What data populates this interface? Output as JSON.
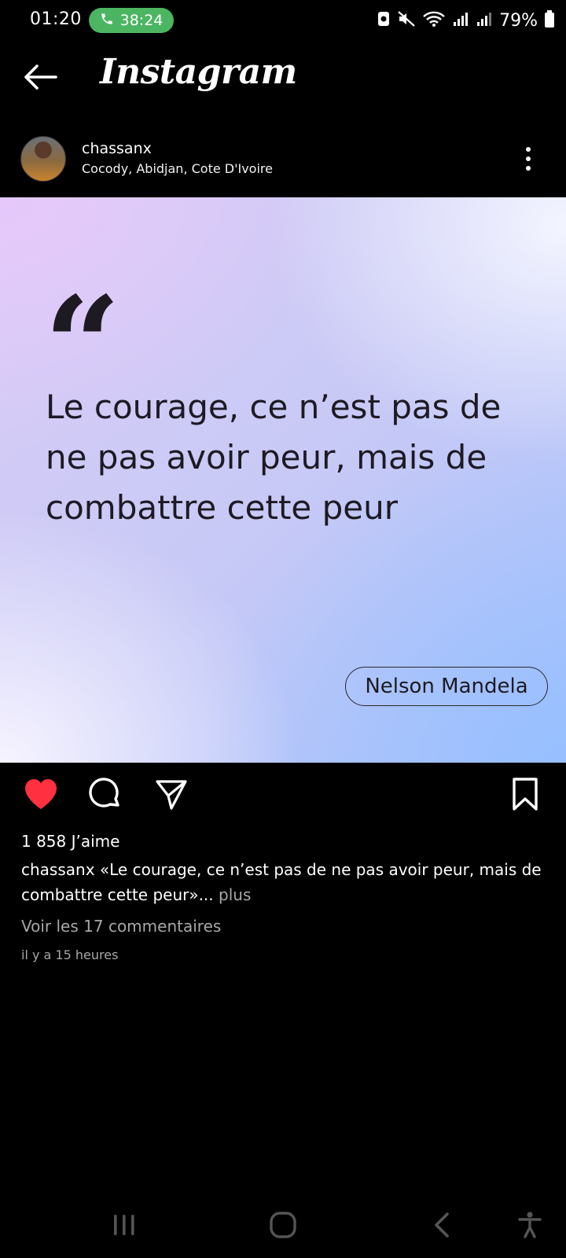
{
  "status_bar": {
    "time": "01:20",
    "call_duration": "38:24",
    "battery_percent": "79%",
    "icons": [
      "phone-icon",
      "screenshot-icon",
      "mute-icon",
      "wifi-icon",
      "signal-icon",
      "signal-icon",
      "battery-icon"
    ]
  },
  "header": {
    "app_title": "Instagram",
    "back_icon": "arrow-left-icon"
  },
  "post": {
    "username": "chassanx",
    "location": "Cocody, Abidjan, Cote D'Ivoire",
    "image": {
      "quote_mark": "“",
      "quote_text": "Le courage, ce n’est pas de ne pas avoir peur, mais de combattre cette peur",
      "author": "Nelson Mandela"
    },
    "liked": true,
    "likes_text": "1 858 J’aime",
    "caption_user": "chassanx",
    "caption_text": "«Le courage, ce n’est pas de ne pas avoir peur, mais de combattre cette peur»...",
    "caption_more": "plus",
    "comments_link": "Voir les 17 commentaires",
    "timestamp": "il y a 15 heures"
  },
  "colors": {
    "background": "#000000",
    "like_red": "#ff3040",
    "call_green": "#4cb562",
    "muted_text": "#a8a8a8"
  },
  "navbar": {
    "icons": [
      "recent-apps-icon",
      "home-icon",
      "back-icon",
      "accessibility-icon"
    ]
  }
}
